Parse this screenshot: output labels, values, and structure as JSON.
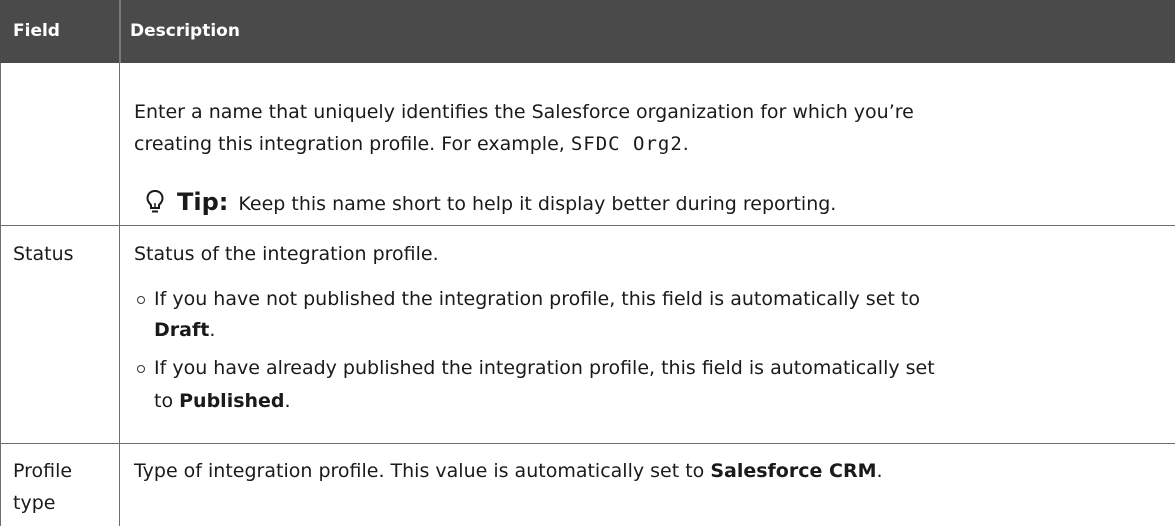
{
  "header": {
    "field": "Field",
    "description": "Description"
  },
  "rows": [
    {
      "field": "",
      "desc_line1": "Enter a name that uniquely identifies the Salesforce organization for which you’re",
      "desc_line2_prefix": "creating this integration profile. For example, ",
      "example_code": "SFDC Org2",
      "desc_line2_suffix": ".",
      "tip_label": "Tip:",
      "tip_text": "Keep this name short to help it display better during reporting.",
      "tip_icon": "lightbulb-icon"
    },
    {
      "field": "Status",
      "desc": "Status of the integration profile.",
      "bullets": [
        {
          "line1": "If you have not published the integration profile, this field is automatically set to",
          "value": "Draft",
          "suffix": "."
        },
        {
          "line1": "If you have already published the integration profile, this field is automatically set",
          "prefix2": "to ",
          "value": "Published",
          "suffix": "."
        }
      ]
    },
    {
      "field_line1": "Profile",
      "field_line2": "type",
      "desc_prefix": "Type of integration profile. This value is automatically set to ",
      "value": "Salesforce CRM",
      "suffix": "."
    }
  ]
}
